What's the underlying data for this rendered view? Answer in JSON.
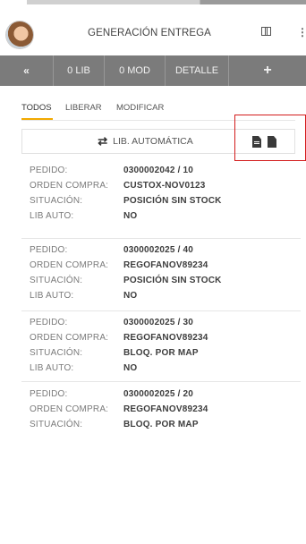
{
  "header": {
    "title": "GENERACIÓN ENTREGA",
    "icons": [
      "avatar",
      "columns-icon",
      "more-icon"
    ]
  },
  "toolbar": {
    "back_label": "«",
    "lib_label": "0 LIB",
    "mod_label": "0 MOD",
    "detail_label": "DETALLE",
    "add_label": "+"
  },
  "tabs": [
    {
      "label": "TODOS",
      "active": true
    },
    {
      "label": "LIBERAR",
      "active": false
    },
    {
      "label": "MODIFICAR",
      "active": false
    }
  ],
  "filter": {
    "lib_auto_label": "LIB. AUTOMÁTICA",
    "icons": [
      "swap-icon",
      "doc-lines-icon",
      "doc-icon"
    ]
  },
  "orders": [
    {
      "fields": [
        {
          "label": "PEDIDO:",
          "value": "0300002042 / 10"
        },
        {
          "label": "ORDEN COMPRA:",
          "value": "CUSTOX-NOV0123"
        },
        {
          "label": "SITUACIÓN:",
          "value": "POSICIÓN SIN STOCK"
        },
        {
          "label": "LIB AUTO:",
          "value": "NO"
        }
      ]
    },
    {
      "fields": [
        {
          "label": "PEDIDO:",
          "value": "0300002025 / 40"
        },
        {
          "label": "ORDEN COMPRA:",
          "value": "REGOFANOV89234"
        },
        {
          "label": "SITUACIÓN:",
          "value": "POSICIÓN SIN STOCK"
        },
        {
          "label": "LIB AUTO:",
          "value": "NO"
        }
      ]
    },
    {
      "fields": [
        {
          "label": "PEDIDO:",
          "value": "0300002025 / 30"
        },
        {
          "label": "ORDEN COMPRA:",
          "value": "REGOFANOV89234"
        },
        {
          "label": "SITUACIÓN:",
          "value": "BLOQ. POR MAP"
        },
        {
          "label": "LIB AUTO:",
          "value": "NO"
        }
      ]
    },
    {
      "fields": [
        {
          "label": "PEDIDO:",
          "value": "0300002025 / 20"
        },
        {
          "label": "ORDEN COMPRA:",
          "value": "REGOFANOV89234"
        },
        {
          "label": "SITUACIÓN:",
          "value": "BLOQ. POR MAP"
        }
      ]
    }
  ],
  "colors": {
    "toolbar_bg": "#7b7b7b",
    "active_tab": "#f2a900",
    "highlight": "#d31b1b"
  }
}
